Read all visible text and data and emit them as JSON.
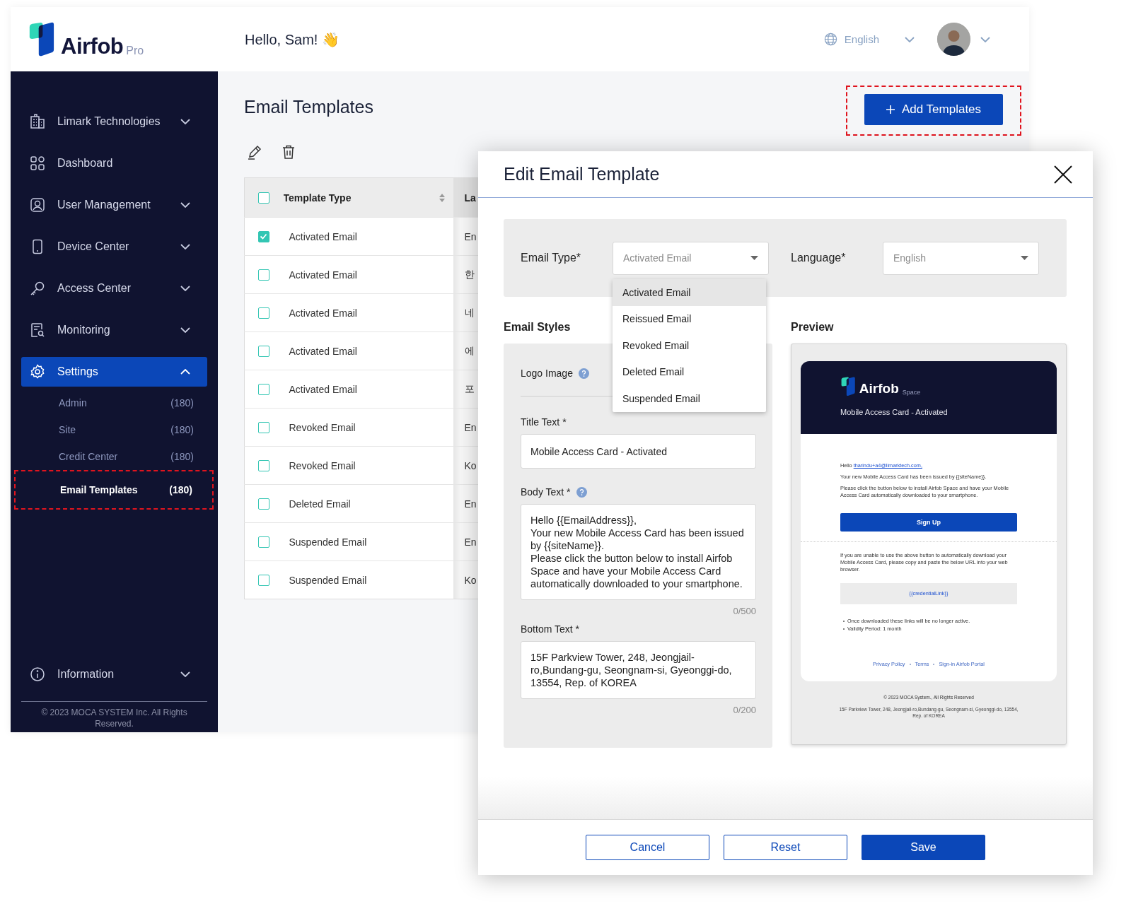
{
  "header": {
    "brand": "Airfob",
    "brand_suffix": "Pro",
    "greeting": "Hello, Sam! 👋",
    "language": "English"
  },
  "sidebar": {
    "items": [
      {
        "label": "Limark Technologies",
        "selected": false,
        "expanded": false
      },
      {
        "label": "Dashboard",
        "selected": false
      },
      {
        "label": "User Management",
        "selected": false,
        "expanded": false
      },
      {
        "label": "Device Center",
        "selected": false,
        "expanded": false
      },
      {
        "label": "Access Center",
        "selected": false,
        "expanded": false
      },
      {
        "label": "Monitoring",
        "selected": false,
        "expanded": false
      },
      {
        "label": "Settings",
        "selected": true,
        "expanded": true,
        "children": [
          {
            "label": "Admin",
            "count": "(180)",
            "selected": false,
            "highlighted": false
          },
          {
            "label": "Site",
            "count": "(180)",
            "selected": false,
            "highlighted": false
          },
          {
            "label": "Credit Center",
            "count": "(180)",
            "selected": false,
            "highlighted": false
          },
          {
            "label": "Email Templates",
            "count": "(180)",
            "selected": true,
            "highlighted": true
          }
        ]
      }
    ],
    "information": {
      "label": "Information",
      "expanded": false
    },
    "footer": "© 2023 MOCA SYSTEM Inc. All Rights Reserved."
  },
  "page": {
    "title": "Email Templates",
    "add_button": {
      "label": "Add Templates",
      "highlighted": true
    }
  },
  "table": {
    "all_checked": false,
    "columns": [
      {
        "label": "Template Type",
        "sortable": true
      },
      {
        "label": "La"
      }
    ],
    "rows": [
      {
        "checked": true,
        "template_type": "Activated Email",
        "language": "En"
      },
      {
        "checked": false,
        "template_type": "Activated Email",
        "language": "한"
      },
      {
        "checked": false,
        "template_type": "Activated Email",
        "language": "네"
      },
      {
        "checked": false,
        "template_type": "Activated Email",
        "language": "에"
      },
      {
        "checked": false,
        "template_type": "Activated Email",
        "language": "포"
      },
      {
        "checked": false,
        "template_type": "Revoked Email",
        "language": "En"
      },
      {
        "checked": false,
        "template_type": "Revoked Email",
        "language": "Ko"
      },
      {
        "checked": false,
        "template_type": "Deleted Email",
        "language": "En"
      },
      {
        "checked": false,
        "template_type": "Suspended Email",
        "language": "En"
      },
      {
        "checked": false,
        "template_type": "Suspended Email",
        "language": "Ko"
      }
    ]
  },
  "modal": {
    "title": "Edit Email Template",
    "email_type": {
      "label": "Email Type*",
      "value": "Activated Email",
      "open": true,
      "options": [
        {
          "label": "Activated Email",
          "selected": true
        },
        {
          "label": "Reissued Email",
          "selected": false
        },
        {
          "label": "Revoked Email",
          "selected": false
        },
        {
          "label": "Deleted Email",
          "selected": false
        },
        {
          "label": "Suspended Email",
          "selected": false
        }
      ]
    },
    "language": {
      "label": "Language*",
      "value": "English"
    },
    "styles_heading": "Email Styles",
    "logo_label": "Logo Image",
    "title_text": {
      "label": "Title Text *",
      "value": "Mobile Access Card - Activated"
    },
    "body_text": {
      "label": "Body Text *",
      "value": "Hello {{EmailAddress}},\nYour new Mobile Access Card has been issued by {{siteName}}.\nPlease click the button below to install Airfob Space and have your Mobile Access Card automatically downloaded to your smartphone.",
      "counter": "0/500"
    },
    "bottom_text": {
      "label": "Bottom Text *",
      "value": "15F Parkview Tower, 248, Jeongjail-ro,Bundang-gu, Seongnam-si, Gyeonggi-do, 13554, Rep. of KOREA",
      "counter": "0/200"
    },
    "preview": {
      "heading": "Preview",
      "brand": "Airfob",
      "brand_suffix": "Space",
      "subject": "Mobile Access Card - Activated",
      "hello": "Hello",
      "email": "tharindu+a4@limarktech.com,",
      "lines": [
        "Your new Mobile Access Card has been issued by {{siteName}}.",
        "Please click the button below to install Airfob Space and have your Mobile Access Card automatically downloaded to your smartphone."
      ],
      "button": "Sign Up",
      "fallback": "If you are unable to use the above button to automatically download your Mobile Access Card, please copy and paste the below URL into your web browser.",
      "link": "{{credentialLink}}",
      "notes": [
        "Once downloaded these links will be no longer active.",
        "Validity Period: 1 month"
      ],
      "footer_links": [
        "Privacy Policy",
        "Terms",
        "Sign-in Airfob Portal"
      ],
      "copyright": "© 2023 MOCA System., All Rights Reserved",
      "address": "15F Parkview Tower, 248, Jeongjail-ro,Bundang-gu, Seongnam-si, Gyeonggi-do, 13554, Rep. of KOREA"
    },
    "buttons": [
      {
        "label": "Cancel",
        "kind": "outline"
      },
      {
        "label": "Reset",
        "kind": "outline"
      },
      {
        "label": "Save",
        "kind": "primary"
      }
    ]
  }
}
